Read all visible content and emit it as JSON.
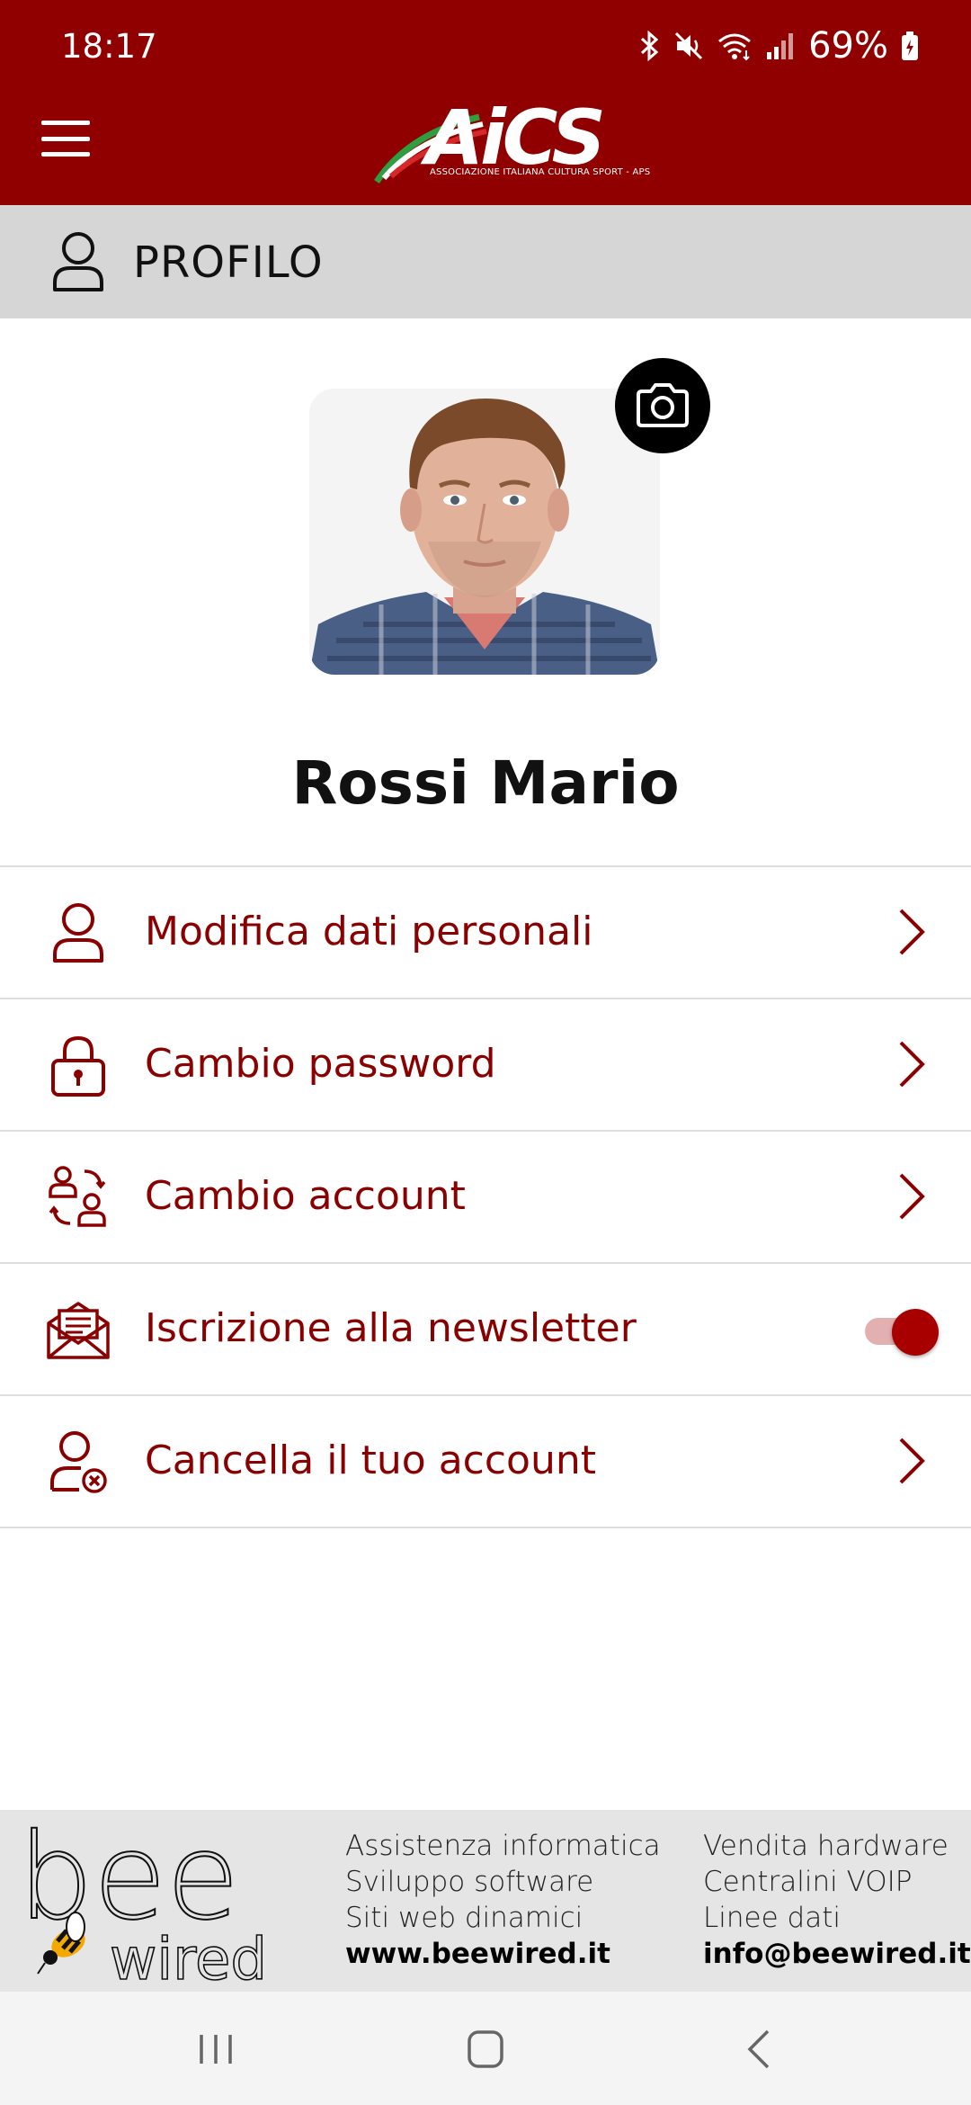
{
  "status_bar": {
    "time": "18:17",
    "battery": "69%"
  },
  "header": {
    "logo_text": "AiCS",
    "logo_subtitle": "ASSOCIAZIONE ITALIANA CULTURA SPORT - APS"
  },
  "section": {
    "title": "PROFILO"
  },
  "profile": {
    "name": "Rossi Mario"
  },
  "menu": [
    {
      "label": "Modifica dati personali",
      "icon": "user-icon",
      "control": "chevron"
    },
    {
      "label": "Cambio password",
      "icon": "lock-icon",
      "control": "chevron"
    },
    {
      "label": "Cambio account",
      "icon": "switch-account-icon",
      "control": "chevron"
    },
    {
      "label": "Iscrizione alla newsletter",
      "icon": "newsletter-envelope-icon",
      "control": "toggle",
      "toggle_on": true
    },
    {
      "label": "Cancella il tuo account",
      "icon": "delete-account-icon",
      "control": "chevron"
    }
  ],
  "footer": {
    "brand_top": "bee",
    "brand_bottom": "wired",
    "col1": [
      "Assistenza informatica",
      "Sviluppo software",
      "Siti web dinamici",
      "www.beewired.it"
    ],
    "col2": [
      "Vendita hardware",
      "Centralini VOIP",
      "Linee dati",
      "info@beewired.it"
    ]
  },
  "colors": {
    "brand_red": "#900000",
    "text_red": "#8a0000",
    "section_gray": "#d6d6d6",
    "footer_gray": "#e5e5e5"
  }
}
